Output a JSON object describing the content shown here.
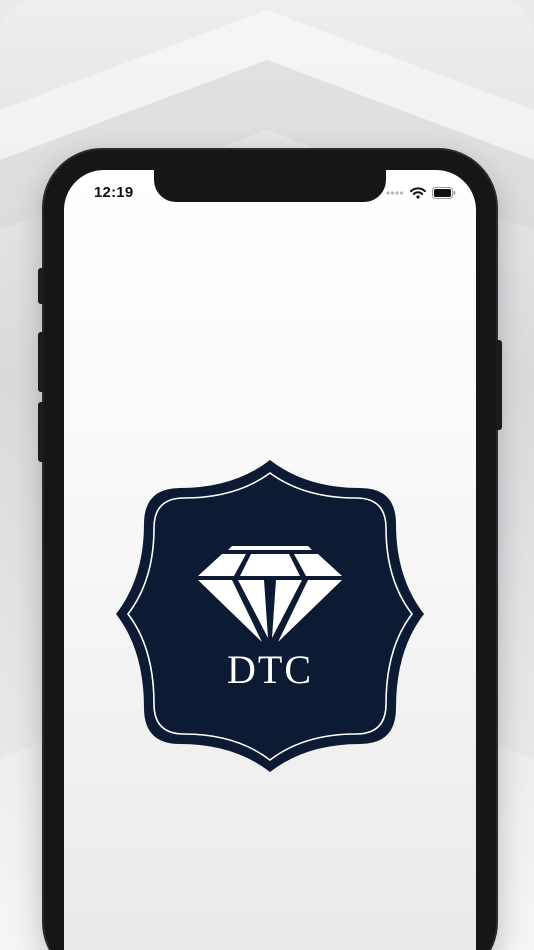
{
  "status_bar": {
    "time": "12:19"
  },
  "logo": {
    "text": "DTC",
    "icon": "diamond-icon",
    "badge_color": "#0d1a33",
    "border_color": "#ffffff"
  },
  "colors": {
    "phone_frame": "#161616",
    "screen_bg": "#ffffff"
  }
}
